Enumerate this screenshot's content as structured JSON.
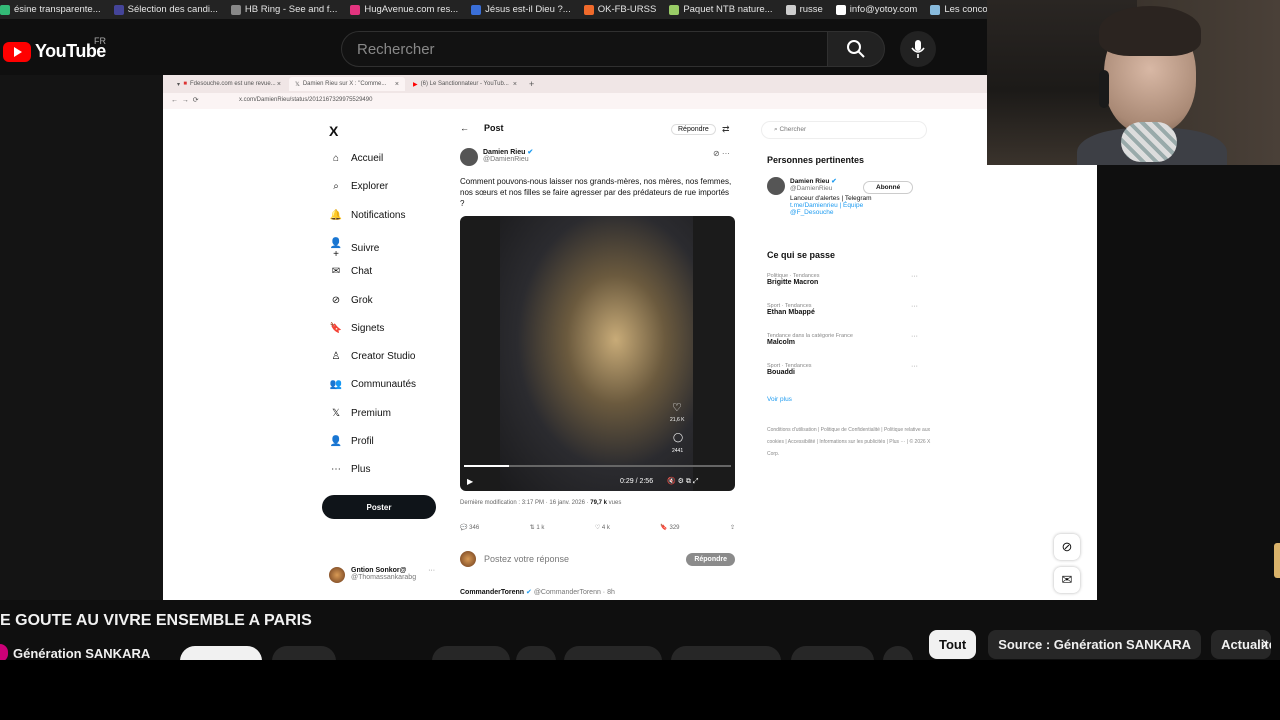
{
  "bookmarks": [
    "ésine transparente...",
    "Sélection des candi...",
    "HB Ring - See and f...",
    "HugAvenue.com res...",
    "Jésus est-il Dieu ?...",
    "OK-FB-URSS",
    "Paquet NTB nature...",
    "russe",
    "info@yotoy.com",
    "Les concours d'aute..."
  ],
  "youtube": {
    "logo": "YouTube",
    "region": "FR",
    "search_placeholder": "Rechercher"
  },
  "browser": {
    "tabs": [
      "Fdesouche.com est une revue...",
      "Damien Rieu sur X : \"Comme...",
      "(6) Le Sanctionnateur - YouTub..."
    ],
    "url": "x.com/DamienRieu/status/2012167329975529490"
  },
  "x": {
    "logo": "X",
    "nav": [
      "Accueil",
      "Explorer",
      "Notifications",
      "Suivre",
      "Chat",
      "Grok",
      "Signets",
      "Creator Studio",
      "Communautés",
      "Premium",
      "Profil",
      "Plus"
    ],
    "post_button": "Poster",
    "account": {
      "name": "Gntion Sonkor@",
      "handle": "@Thomassankarabg"
    },
    "post_header": "Post",
    "reply_top": "Répondre",
    "author": {
      "name": "Damien Rieu",
      "handle": "@DamienRieu"
    },
    "text": "Comment pouvons-nous laisser nos grands-mères, nos mères, nos femmes, nos sœurs et nos filles se faire agresser par des prédateurs de rue importés ?",
    "video": {
      "time": "0:29 / 2:56",
      "likes": "21,6 K",
      "comments": "2441",
      "progress": 0.17
    },
    "meta_prefix": "Dernière modification : 3:17 PM · 16 janv. 2026 · ",
    "views": "79,7 k",
    "views_suffix": " vues",
    "stats": {
      "replies": "346",
      "reposts": "1 k",
      "likes": "4 k",
      "bookmarks": "329"
    },
    "reply_placeholder": "Postez votre réponse",
    "reply_button": "Répondre",
    "next_reply": {
      "name": "CommanderTorenn",
      "handle": "@CommanderTorenn · 8h"
    },
    "sidebar": {
      "search": "Chercher",
      "relevant_title": "Personnes pertinentes",
      "person": {
        "name": "Damien Rieu",
        "handle": "@DamienRieu",
        "bio1": "Lanceur d'alertes | Telegram",
        "bio2": "t.me/Damienrieu | Équipe",
        "bio3": "@F_Desouche",
        "button": "Abonné"
      },
      "trends_title": "Ce qui se passe",
      "trends": [
        {
          "cat": "Politique · Tendances",
          "name": "Brigitte Macron"
        },
        {
          "cat": "Sport · Tendances",
          "name": "Ethan Mbappé"
        },
        {
          "cat": "Tendance dans la catégorie France",
          "name": "Malcolm"
        },
        {
          "cat": "Sport · Tendances",
          "name": "Bouaddi"
        }
      ],
      "show_more": "Voir plus",
      "footer": "Conditions d'utilisation | Politique de Confidentialité | Politique relative aux cookies | Accessibilité | Informations sur les publicités | Plus ··· | © 2026 X Corp."
    }
  },
  "video_title": "E GOUTE AU VIVRE ENSEMBLE A PARIS",
  "channel": "Génération SANKARA",
  "chips": [
    "Tout",
    "Source : Génération SANKARA",
    "Actualité"
  ]
}
